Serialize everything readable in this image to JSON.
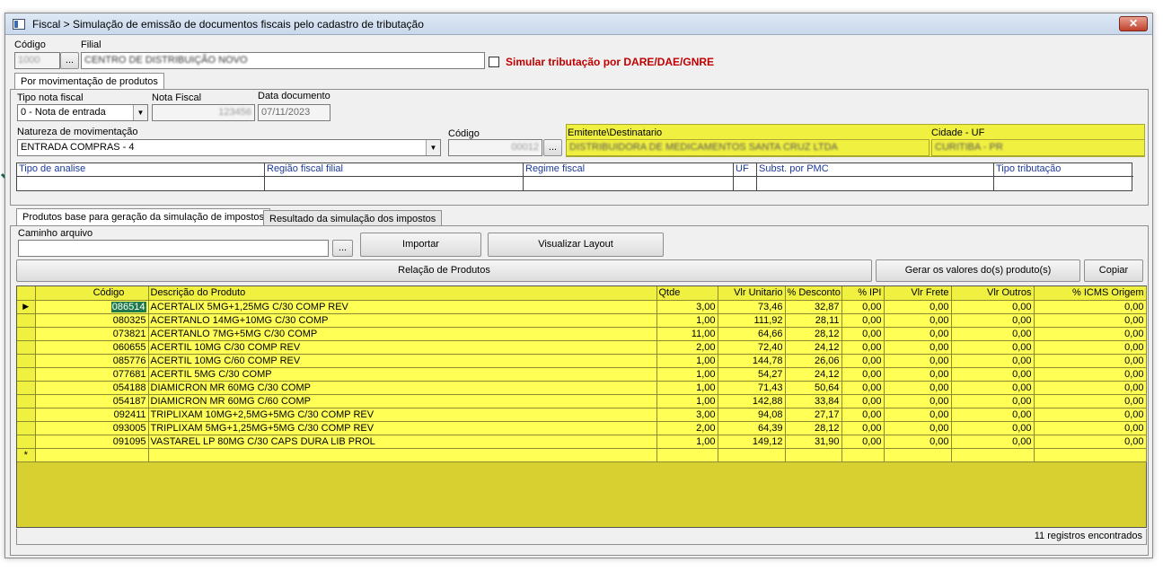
{
  "window": {
    "title": "Fiscal > Simulação de emissão de documentos fiscais pelo cadastro de tributação",
    "close_label": "✕"
  },
  "header": {
    "codigo_label": "Código",
    "codigo_value": "1000",
    "filial_label": "Filial",
    "filial_value": "CENTRO DE DISTRIBUIÇÃO NOVO",
    "ellipsis": "...",
    "simular_label": "Simular tributação por DARE/DAE/GNRE"
  },
  "tabs_top": [
    "Por movimentação de produtos"
  ],
  "movimentacao": {
    "tipo_nota_label": "Tipo nota fiscal",
    "tipo_nota_value": "0 - Nota de entrada",
    "nota_fiscal_label": "Nota Fiscal",
    "nota_fiscal_value": "123456",
    "data_doc_label": "Data documento",
    "data_doc_value": "07/11/2023",
    "natureza_label": "Natureza de movimentação",
    "natureza_value": "ENTRADA COMPRAS - 4",
    "codigo_label": "Código",
    "codigo_value": "00012",
    "emitente_label": "Emitente\\Destinatario",
    "emitente_value": "DISTRIBUIDORA DE MEDICAMENTOS SANTA CRUZ LTDA",
    "cidade_label": "Cidade - UF",
    "cidade_value": "CURITIBA - PR"
  },
  "info_grid": {
    "headers": [
      "Tipo de analise",
      "Região fiscal filial",
      "Regime fiscal",
      "UF",
      "Subst. por PMC",
      "Tipo tributação"
    ]
  },
  "tabs_bottom": [
    "Produtos base para geração da simulação de impostos",
    "Resultado da simulação dos impostos"
  ],
  "import": {
    "caminho_label": "Caminho arquivo",
    "caminho_value": "",
    "importar_label": "Importar",
    "visualizar_label": "Visualizar Layout",
    "relacao_label": "Relação de Produtos",
    "gerar_label": "Gerar os valores do(s) produto(s)",
    "copiar_label": "Copiar"
  },
  "products": {
    "columns": [
      "Código",
      "Descrição do Produto",
      "Qtde",
      "Vlr Unitario",
      "% Desconto",
      "% IPI",
      "Vlr Frete",
      "Vlr Outros",
      "% ICMS Origem"
    ],
    "rows": [
      {
        "codigo": "086514",
        "descricao": "ACERTALIX 5MG+1,25MG C/30 COMP REV",
        "qtde": "3,00",
        "vlr_unitario": "73,46",
        "desconto": "32,87",
        "ipi": "0,00",
        "frete": "0,00",
        "outros": "0,00",
        "icms": "0,00"
      },
      {
        "codigo": "080325",
        "descricao": "ACERTANLO 14MG+10MG C/30 COMP",
        "qtde": "1,00",
        "vlr_unitario": "111,92",
        "desconto": "28,11",
        "ipi": "0,00",
        "frete": "0,00",
        "outros": "0,00",
        "icms": "0,00"
      },
      {
        "codigo": "073821",
        "descricao": "ACERTANLO 7MG+5MG C/30 COMP",
        "qtde": "11,00",
        "vlr_unitario": "64,66",
        "desconto": "28,12",
        "ipi": "0,00",
        "frete": "0,00",
        "outros": "0,00",
        "icms": "0,00"
      },
      {
        "codigo": "060655",
        "descricao": "ACERTIL 10MG C/30 COMP REV",
        "qtde": "2,00",
        "vlr_unitario": "72,40",
        "desconto": "24,12",
        "ipi": "0,00",
        "frete": "0,00",
        "outros": "0,00",
        "icms": "0,00"
      },
      {
        "codigo": "085776",
        "descricao": "ACERTIL 10MG C/60 COMP REV",
        "qtde": "1,00",
        "vlr_unitario": "144,78",
        "desconto": "26,06",
        "ipi": "0,00",
        "frete": "0,00",
        "outros": "0,00",
        "icms": "0,00"
      },
      {
        "codigo": "077681",
        "descricao": "ACERTIL 5MG C/30 COMP",
        "qtde": "1,00",
        "vlr_unitario": "54,27",
        "desconto": "24,12",
        "ipi": "0,00",
        "frete": "0,00",
        "outros": "0,00",
        "icms": "0,00"
      },
      {
        "codigo": "054188",
        "descricao": "DIAMICRON MR 60MG C/30 COMP",
        "qtde": "1,00",
        "vlr_unitario": "71,43",
        "desconto": "50,64",
        "ipi": "0,00",
        "frete": "0,00",
        "outros": "0,00",
        "icms": "0,00"
      },
      {
        "codigo": "054187",
        "descricao": "DIAMICRON MR 60MG C/60 COMP",
        "qtde": "1,00",
        "vlr_unitario": "142,88",
        "desconto": "33,84",
        "ipi": "0,00",
        "frete": "0,00",
        "outros": "0,00",
        "icms": "0,00"
      },
      {
        "codigo": "092411",
        "descricao": "TRIPLIXAM 10MG+2,5MG+5MG C/30 COMP REV",
        "qtde": "3,00",
        "vlr_unitario": "94,08",
        "desconto": "27,17",
        "ipi": "0,00",
        "frete": "0,00",
        "outros": "0,00",
        "icms": "0,00"
      },
      {
        "codigo": "093005",
        "descricao": "TRIPLIXAM 5MG+1,25MG+5MG C/30 COMP REV",
        "qtde": "2,00",
        "vlr_unitario": "64,39",
        "desconto": "28,12",
        "ipi": "0,00",
        "frete": "0,00",
        "outros": "0,00",
        "icms": "0,00"
      },
      {
        "codigo": "091095",
        "descricao": "VASTAREL LP 80MG C/30 CAPS DURA LIB PROL",
        "qtde": "1,00",
        "vlr_unitario": "149,12",
        "desconto": "31,90",
        "ipi": "0,00",
        "frete": "0,00",
        "outros": "0,00",
        "icms": "0,00"
      }
    ],
    "current_indicator": "▶",
    "new_row_indicator": "*"
  },
  "status": {
    "records": "11 registros encontrados"
  },
  "colors": {
    "grid_yellow": "#ffff55",
    "grid_bg": "#d8d030",
    "selection_green": "#1e7a4a",
    "arrow_green": "#1f6b4a",
    "alert_red": "#c00000"
  }
}
